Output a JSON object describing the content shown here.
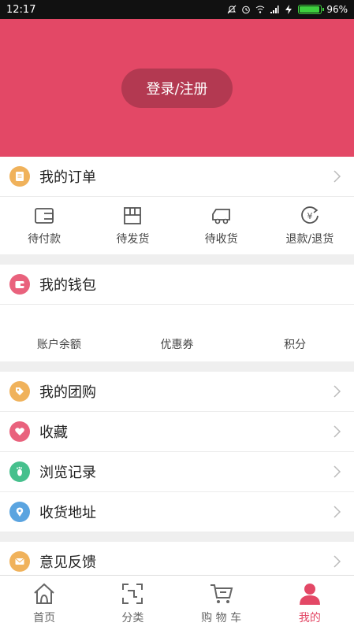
{
  "status": {
    "time": "12:17",
    "battery": "96%",
    "battery_level": 0.96
  },
  "header": {
    "login_label": "登录/注册"
  },
  "orders": {
    "title": "我的订单",
    "items": [
      {
        "label": "待付款",
        "icon": "wallet-card-icon"
      },
      {
        "label": "待发货",
        "icon": "package-icon"
      },
      {
        "label": "待收货",
        "icon": "truck-icon"
      },
      {
        "label": "退款/退货",
        "icon": "refund-icon"
      }
    ]
  },
  "wallet": {
    "title": "我的钱包",
    "items": [
      "账户余额",
      "优惠券",
      "积分"
    ]
  },
  "menu": [
    {
      "label": "我的团购",
      "icon": "tag-icon",
      "color": "#f0b25b"
    },
    {
      "label": "收藏",
      "icon": "heart-icon",
      "color": "#e9627d"
    },
    {
      "label": "浏览记录",
      "icon": "footprint-icon",
      "color": "#46c08d"
    },
    {
      "label": "收货地址",
      "icon": "location-icon",
      "color": "#5aa4e0"
    }
  ],
  "feedback": {
    "label": "意见反馈",
    "icon": "mail-icon",
    "color": "#f0b25b"
  },
  "tabs": [
    {
      "label": "首页",
      "icon": "home-icon"
    },
    {
      "label": "分类",
      "icon": "category-icon"
    },
    {
      "label": "购 物 车",
      "icon": "cart-icon"
    },
    {
      "label": "我的",
      "icon": "profile-icon"
    }
  ],
  "colors": {
    "accent": "#e34866",
    "orders_icon": "#f0b25b",
    "wallet_icon": "#e9627d"
  }
}
